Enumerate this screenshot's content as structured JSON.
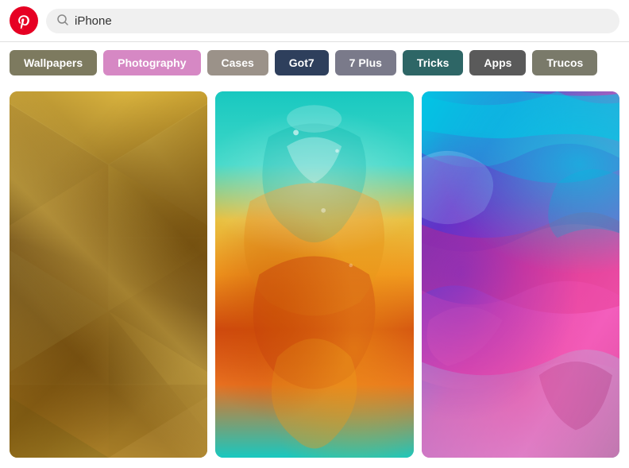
{
  "header": {
    "search_placeholder": "iPhone",
    "search_value": "iPhone"
  },
  "filters": [
    {
      "id": "wallpapers",
      "label": "Wallpapers",
      "css_class": "pill-wallpapers"
    },
    {
      "id": "photography",
      "label": "Photography",
      "css_class": "pill-photography"
    },
    {
      "id": "cases",
      "label": "Cases",
      "css_class": "pill-cases"
    },
    {
      "id": "got7",
      "label": "Got7",
      "css_class": "pill-got7"
    },
    {
      "id": "7plus",
      "label": "7 Plus",
      "css_class": "pill-7plus"
    },
    {
      "id": "tricks",
      "label": "Tricks",
      "css_class": "pill-tricks"
    },
    {
      "id": "apps",
      "label": "Apps",
      "css_class": "pill-apps"
    },
    {
      "id": "trucos",
      "label": "Trucos",
      "css_class": "pill-trucos"
    }
  ],
  "images": [
    {
      "id": "gold-polygon",
      "alt": "Gold geometric polygon art",
      "style_class": "img-gold"
    },
    {
      "id": "liquid-art",
      "alt": "Teal and orange liquid art",
      "style_class": "img-liquid"
    },
    {
      "id": "colorful-swirl",
      "alt": "Colorful swirl paint art",
      "style_class": "img-swirl"
    }
  ],
  "icons": {
    "search": "🔍",
    "logo": "P"
  }
}
